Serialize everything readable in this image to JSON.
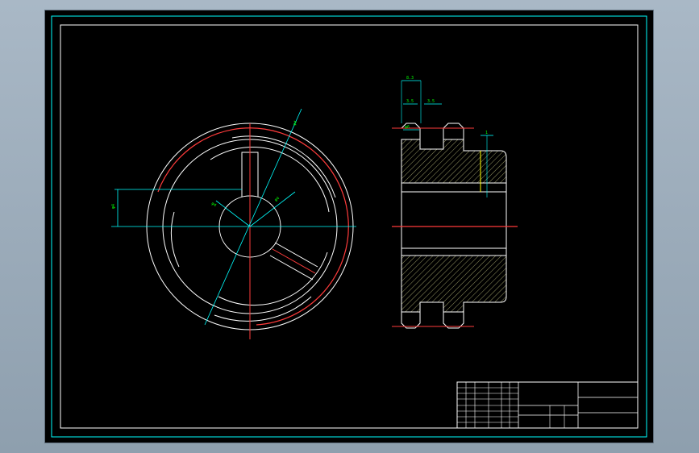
{
  "drawing": {
    "colors": {
      "background": "#000000",
      "outline": "#ffffff",
      "frame": "#ffffff",
      "border": "#00ffff",
      "centerline": "#ff0000",
      "dimension": "#00ffff",
      "dimension_text": "#00ff00",
      "hatch": "#ffffaa",
      "section_edge": "#ffff00"
    },
    "front_view": {
      "dimensions": [
        "φ4",
        "φ4",
        "φ4",
        "φ4"
      ]
    },
    "side_view": {
      "dimensions": [
        "8.3",
        "3.5",
        "3.5",
        "φ6",
        "1"
      ]
    },
    "title_block": {
      "cells": [
        "",
        "",
        "",
        "",
        "",
        "",
        "",
        ""
      ]
    }
  }
}
